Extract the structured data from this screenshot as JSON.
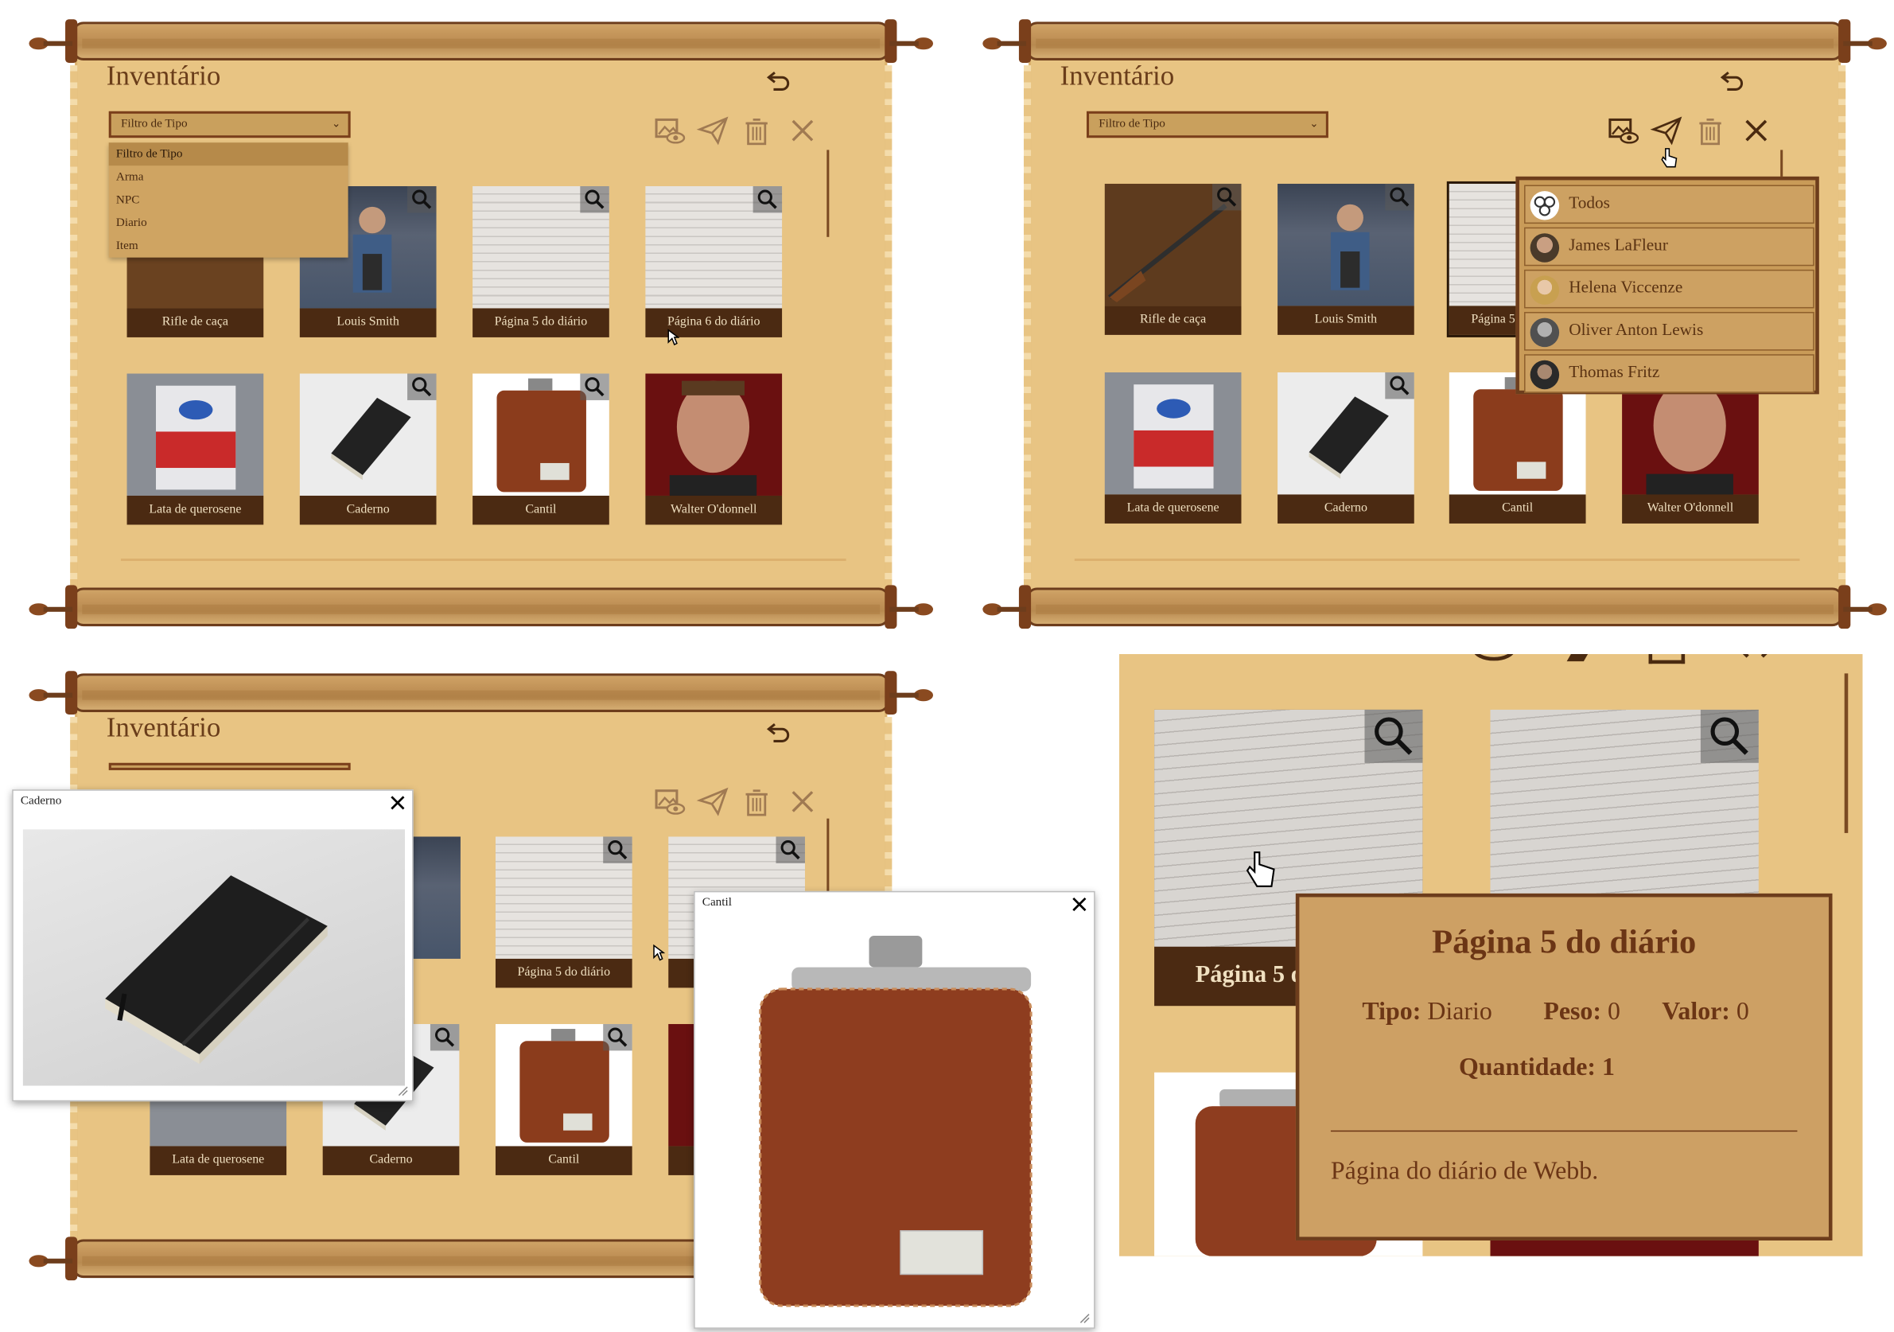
{
  "inventory": {
    "title": "Inventário",
    "filter_label": "Filtro de Tipo",
    "filter_options": [
      "Filtro de Tipo",
      "Arma",
      "NPC",
      "Diario",
      "Item"
    ],
    "items": [
      {
        "name": "Rifle de caça"
      },
      {
        "name": "Louis Smith"
      },
      {
        "name": "Página 5 do diário"
      },
      {
        "name": "Página 6 do diário"
      },
      {
        "name": "Lata de querosene"
      },
      {
        "name": "Caderno"
      },
      {
        "name": "Cantil"
      },
      {
        "name": "Walter O'donnell"
      }
    ],
    "toolbar_icons": [
      "view-image-icon",
      "send-icon",
      "trash-icon",
      "close-icon"
    ],
    "back_icon": "undo-icon"
  },
  "send_menu": {
    "recipients": [
      {
        "name": "Todos"
      },
      {
        "name": "James LaFleur"
      },
      {
        "name": "Helena Viccenze"
      },
      {
        "name": "Oliver Anton Lewis"
      },
      {
        "name": "Thomas Fritz"
      }
    ]
  },
  "popups": {
    "caderno_title": "Caderno",
    "cantil_title": "Cantil"
  },
  "tooltip": {
    "title": "Página 5 do diário",
    "tipo_label": "Tipo:",
    "tipo_value": "Diario",
    "peso_label": "Peso:",
    "peso_value": "0",
    "valor_label": "Valor:",
    "valor_value": "0",
    "quantidade_label": "Quantidade:",
    "quantidade_value": "1",
    "description": "Página do diário de Webb."
  },
  "detail_view": {
    "card_label_partial": "Página 5 d"
  },
  "colors": {
    "parchment": "#e8c483",
    "wood": "#6d3d1c",
    "label_bg": "#4b2a12",
    "tooltip_bg": "#cda064"
  }
}
